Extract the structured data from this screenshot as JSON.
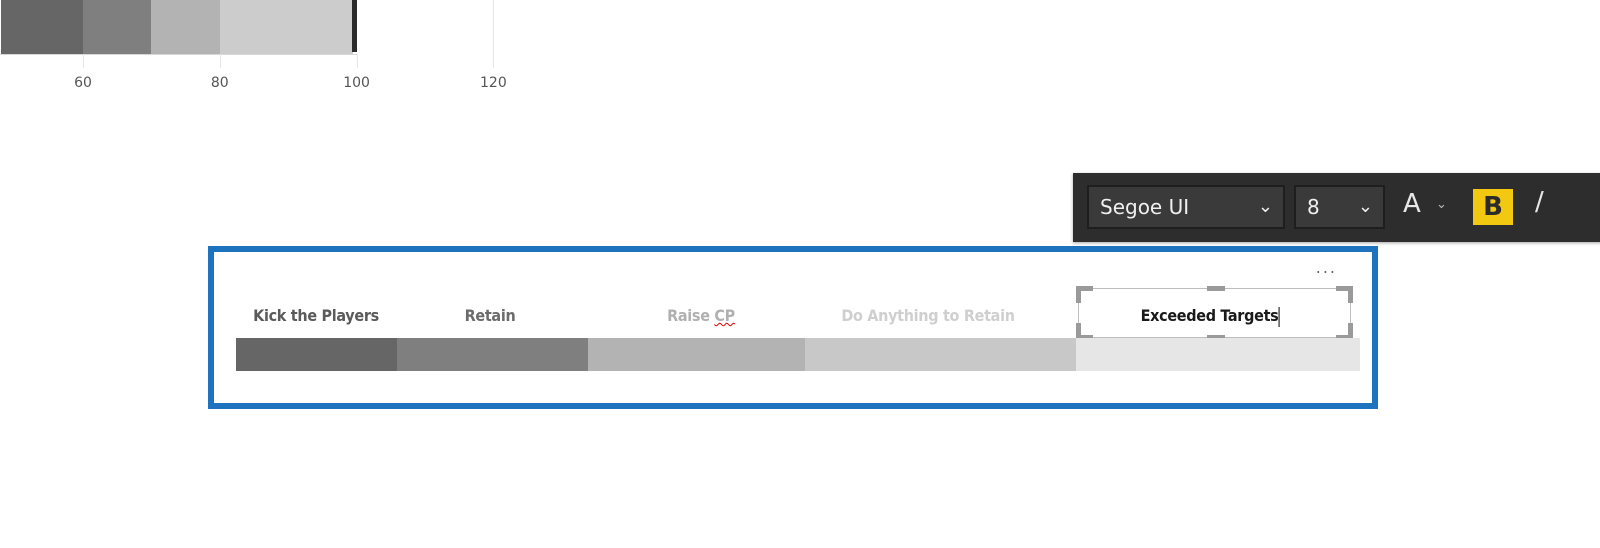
{
  "chart_data": {
    "type": "bar",
    "subtype": "bullet",
    "bands": [
      {
        "name": "Kick the Players",
        "from": 48,
        "to": 60,
        "color": "#666666"
      },
      {
        "name": "Retain",
        "from": 60,
        "to": 70,
        "color": "#7f7f7f"
      },
      {
        "name": "Raise CP",
        "from": 70,
        "to": 80,
        "color": "#b3b3b3"
      },
      {
        "name": "Do Anything to Retain",
        "from": 80,
        "to": 99.5,
        "color": "#cccccc"
      }
    ],
    "target": 100,
    "x_ticks": [
      60,
      80,
      100,
      120
    ],
    "xlim": [
      48,
      124
    ],
    "grid": true
  },
  "toolbar": {
    "font_family": "Segoe UI",
    "font_size": "8",
    "font_color_label": "A",
    "bold_label": "B",
    "italic_label": "/",
    "bold_active": true,
    "accent": "#f2c811"
  },
  "legend": {
    "more_options": "...",
    "items": [
      {
        "label": "Kick the Players",
        "color": "#666666",
        "text_color": "#5a5a5a",
        "fraction": 0.143
      },
      {
        "label": "Retain",
        "color": "#7f7f7f",
        "text_color": "#6b6b6b",
        "fraction": 0.17
      },
      {
        "label": "Raise CP",
        "color": "#b3b3b3",
        "text_color": "#b0b0b0",
        "fraction": 0.193
      },
      {
        "label": "Do Anything to Retain",
        "color": "#c8c8c8",
        "text_color": "#cfcfcf",
        "fraction": 0.241
      },
      {
        "label": "Exceeded Targets",
        "color": "#e6e6e6",
        "text_color": "#1a1a1a",
        "fraction": 0.253
      }
    ],
    "editing_label": "Exceeded Targets",
    "border_color": "#1e73be"
  }
}
